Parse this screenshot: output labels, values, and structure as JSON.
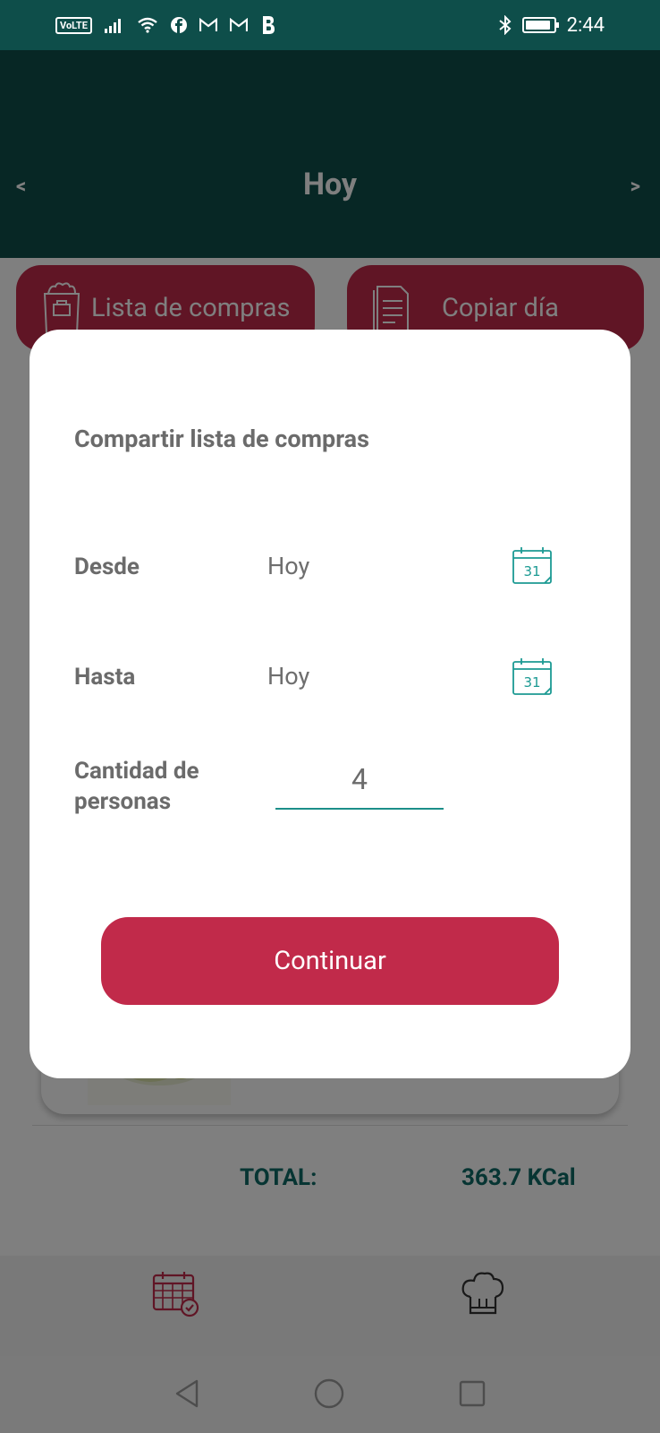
{
  "status_bar": {
    "left_text": "VoLTE",
    "indicators": [
      "signal-icon",
      "wifi-icon",
      "facebook-icon",
      "gmail-icon",
      "gmail-icon",
      "b-icon"
    ],
    "right_icons": [
      "bluetooth-icon",
      "battery-icon"
    ],
    "time": "2:44"
  },
  "header": {
    "prev_label": "<",
    "title": "Hoy",
    "next_label": ">"
  },
  "actions": {
    "shopping_list_label": "Lista de compras",
    "copy_day_label": "Copiar día"
  },
  "summary": {
    "total_label": "TOTAL:",
    "total_value": "363.7 KCal"
  },
  "bottom_nav": {
    "items": [
      "calendar-icon",
      "chef-hat-icon"
    ]
  },
  "dialog": {
    "title": "Compartir lista de compras",
    "from_label": "Desde",
    "from_value": "Hoy",
    "to_label": "Hasta",
    "to_value": "Hoy",
    "calendar_day": "31",
    "people_label_line1": "Cantidad de",
    "people_label_line2": "personas",
    "people_value": "4",
    "continue_label": "Continuar"
  },
  "colors": {
    "header_bg": "#0e4e4a",
    "accent_red": "#c12a4a",
    "teal_text": "#0f6a66",
    "dialog_text": "#6b6b6b",
    "teal_underline": "#1c8f89"
  }
}
